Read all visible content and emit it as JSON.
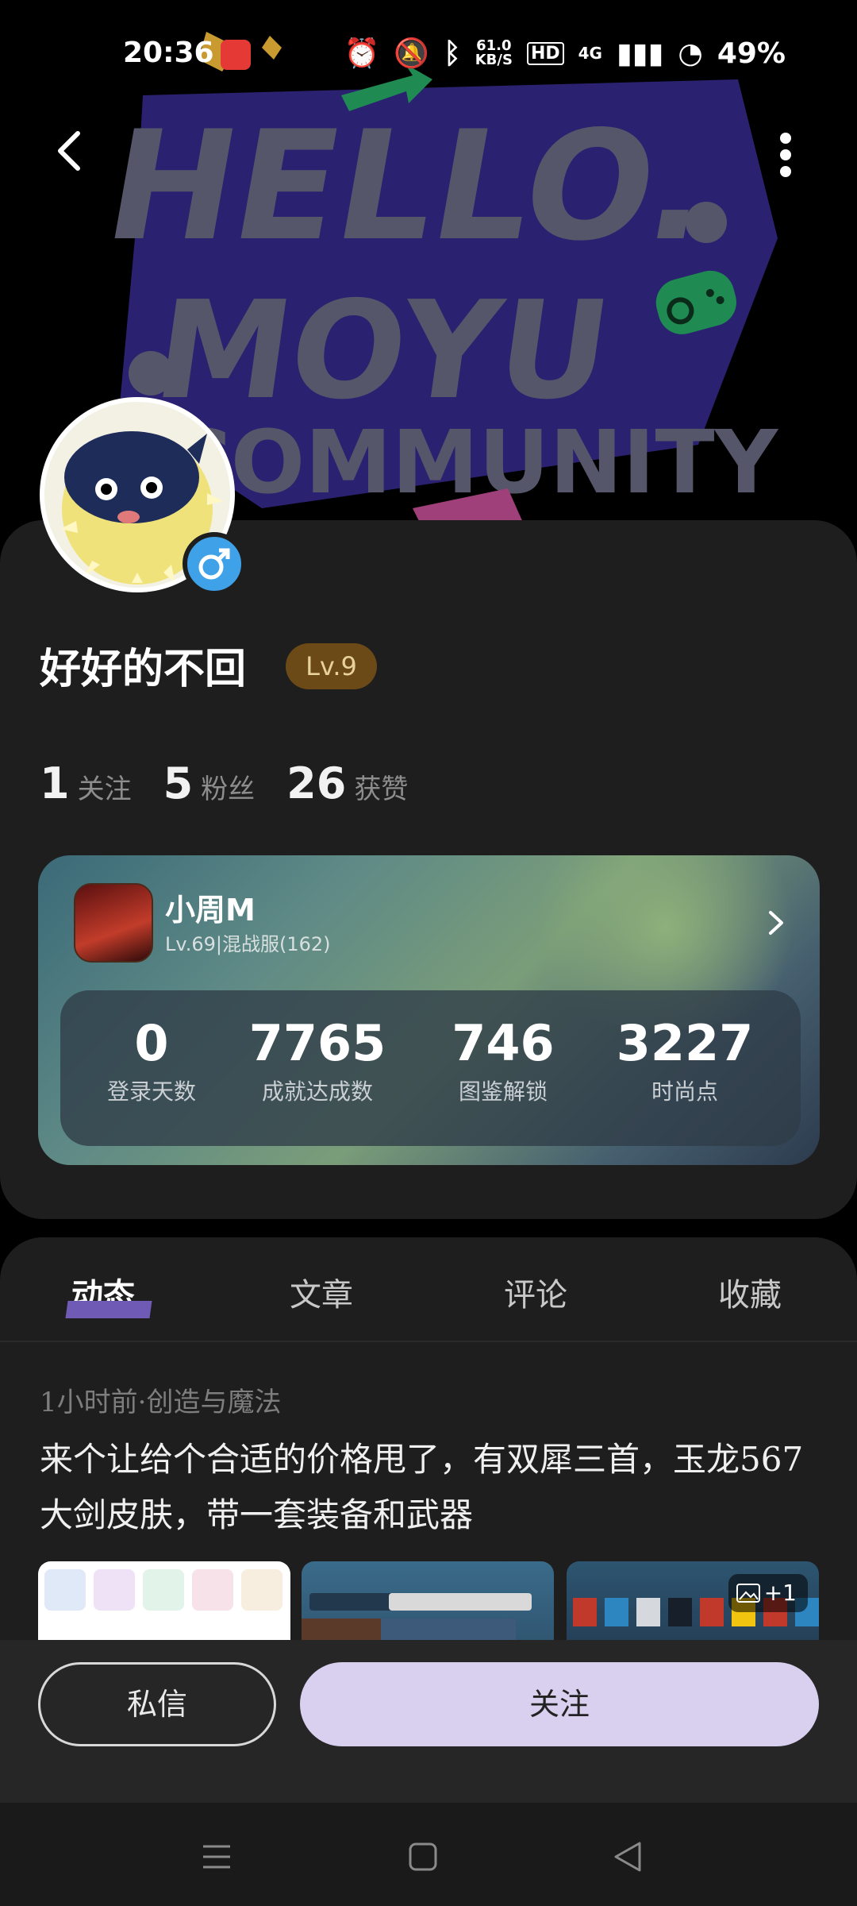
{
  "status_bar": {
    "time": "20:36",
    "speed_value": "61.0",
    "speed_unit": "KB/S",
    "network": "4G",
    "battery": "49%"
  },
  "banner": {
    "line1": "HELLO.",
    "line2": "MOYU",
    "line3": "COMMUNITY"
  },
  "profile": {
    "name": "好好的不回",
    "level": "Lv.9",
    "stats": [
      {
        "value": "1",
        "label": "关注"
      },
      {
        "value": "5",
        "label": "粉丝"
      },
      {
        "value": "26",
        "label": "获赞"
      }
    ]
  },
  "game_card": {
    "name": "小周M",
    "sub": "Lv.69|混战服(162)",
    "stats": [
      {
        "value": "0",
        "label": "登录天数"
      },
      {
        "value": "7765",
        "label": "成就达成数"
      },
      {
        "value": "746",
        "label": "图鉴解锁"
      },
      {
        "value": "3227",
        "label": "时尚点"
      }
    ]
  },
  "tabs": [
    "动态",
    "文章",
    "评论",
    "收藏"
  ],
  "post": {
    "meta": "1小时前·创造与魔法",
    "text": "来个让给个合适的价格甩了，有双犀三首，玉龙567大剑皮肤，带一套装备和武器",
    "more_images": "+1"
  },
  "actions": {
    "message": "私信",
    "follow": "关注"
  },
  "colors": {
    "accent": "#6f5bb5",
    "follow_button": "#d8d0ee",
    "level_badge": "#6b4a17",
    "gender_badge": "#3fa1e8"
  }
}
